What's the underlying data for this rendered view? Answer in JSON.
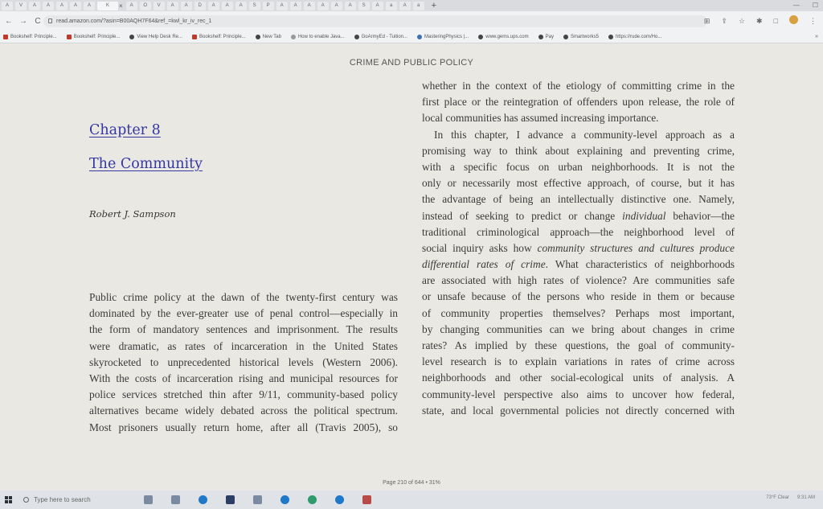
{
  "browser": {
    "tabs": [
      "A",
      "V",
      "A",
      "A",
      "A",
      "A",
      "A",
      "K",
      "A",
      "O",
      "V",
      "A",
      "A",
      "D",
      "A",
      "A",
      "A",
      "S",
      "P",
      "A",
      "A",
      "A",
      "A",
      "A",
      "A",
      "S",
      "A",
      "a",
      "A",
      "a"
    ],
    "active_tab_close": "×",
    "new_tab": "+",
    "url": "read.amazon.com/?asin=B00AQH7F64&ref_=kwl_kr_iv_rec_1",
    "bookmarks": [
      "Bookshelf: Principle...",
      "Bookshelf: Principle...",
      "View Help Desk Re...",
      "Bookshelf: Principle...",
      "New Tab",
      "How to enable Java...",
      "GoArmyEd - Tuition...",
      "MasteringPhysics |...",
      "www.gems.ups.com",
      "Pay",
      "Smartworks5",
      "https://rude.com/Ho..."
    ],
    "bookmarks_more": "»"
  },
  "reader": {
    "running_head": "CRIME AND PUBLIC POLICY",
    "chapter_number": "Chapter 8",
    "chapter_title": "The Community",
    "author": "Robert J. Sampson",
    "left_column_lines": [
      "Public crime policy at the dawn of the twenty-first century was",
      "dominated by the ever-greater use of penal control—especially in",
      "the form of mandatory sentences and imprisonment. The results",
      "were dramatic, as rates of incarceration in the United States",
      "skyrocketed to unprecedented historical levels (Western 2006).",
      "With the costs of incarceration rising and municipal resources for",
      "police services stretched thin after 9/11, community-based policy",
      "alternatives became widely debated across the political spectrum.",
      "Most prisoners usually return home, after all (Travis 2005), so"
    ],
    "right_column_lines": [
      "whether in the context of the etiology of committing crime in the",
      "first place or the reintegration of offenders upon release, the role of",
      "local communities has assumed increasing importance.",
      "In this chapter, I advance a community-level approach as a",
      "promising way to think about explaining and preventing crime,",
      "with a specific focus on urban neighborhoods. It is not the",
      "only or necessarily most effective approach, of course, but it has",
      "the advantage of being an intellectually distinctive one. Namely,",
      "instead of seeking to predict or change individual behavior—the",
      "traditional criminological approach—the neighborhood level of",
      "social inquiry asks how community structures and cultures produce",
      "differential rates of crime. What characteristics of neighborhoods",
      "are associated with high rates of violence? Are communities safe",
      "or unsafe because of the persons who reside in them or because",
      "of community properties themselves? Perhaps most important,",
      "by changing communities can we bring about changes in crime",
      "rates? As implied by these questions, the goal of community-",
      "level research is to explain variations in rates of crime across",
      "neighborhoods and other social-ecological units of analysis. A",
      "community-level perspective also aims to uncover how federal,",
      "state, and local governmental policies not directly concerned with"
    ],
    "page_status": "Page 210 of 644 • 31%"
  },
  "taskbar": {
    "search_placeholder": "Type here to search",
    "tray_weather": "73°F Clear",
    "tray_time": "9:31 AM"
  },
  "colors": {
    "heading_blue": "#3436a2",
    "page_bg": "#e9e8e3"
  }
}
